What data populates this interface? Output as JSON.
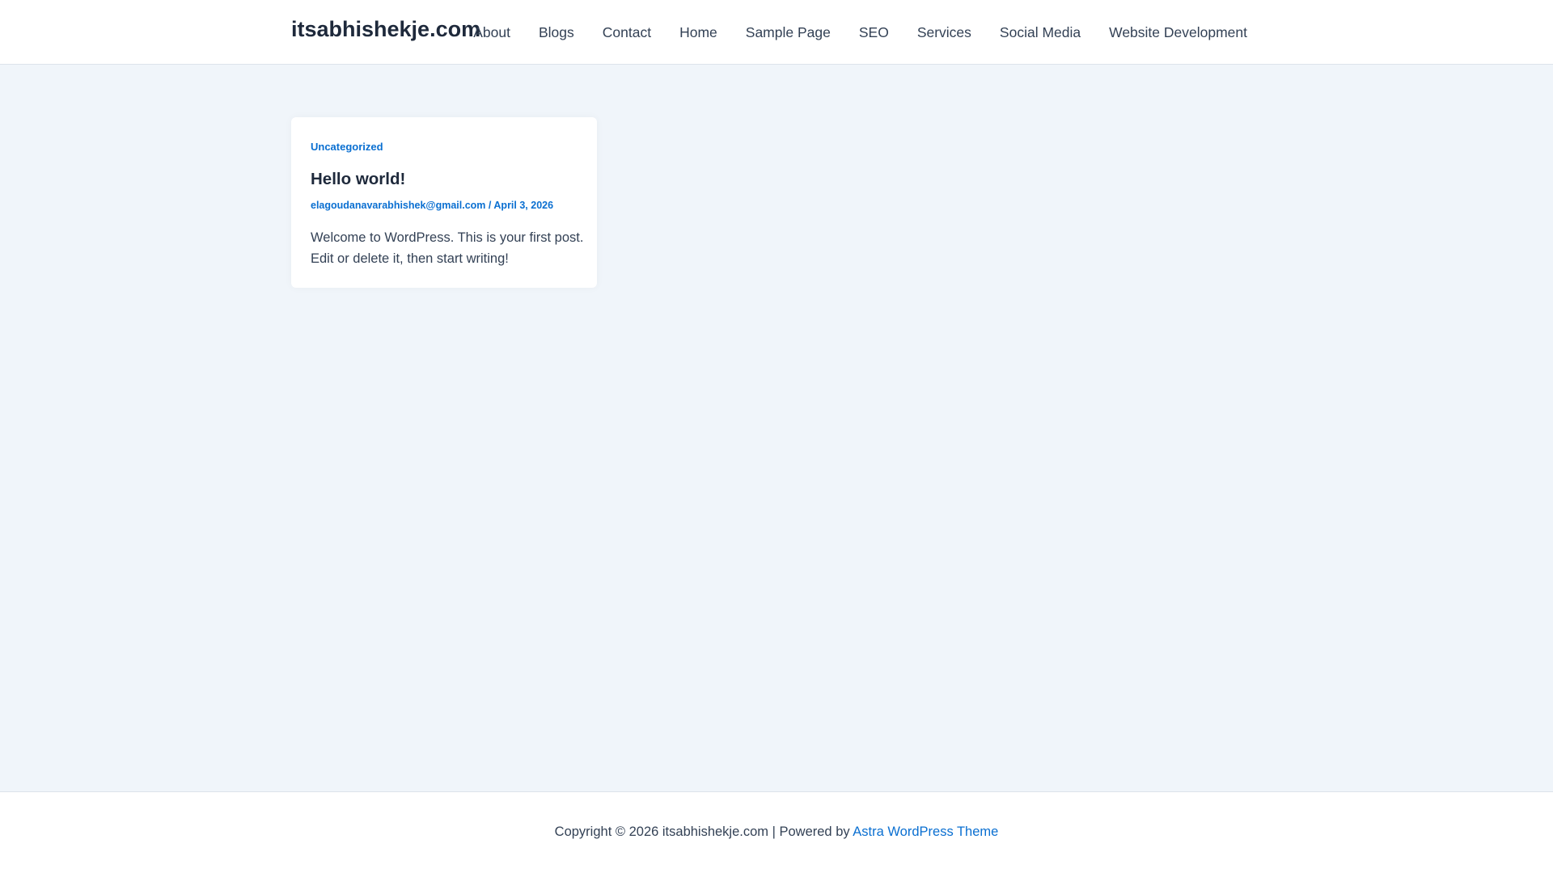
{
  "header": {
    "site_title": "itsabhishekje.com",
    "nav": [
      "About",
      "Blogs",
      "Contact",
      "Home",
      "Sample Page",
      "SEO",
      "Services",
      "Social Media",
      "Website Development"
    ]
  },
  "post": {
    "category": "Uncategorized",
    "title": "Hello world!",
    "author": "elagoudanavarabhishek@gmail.com",
    "separator": " / ",
    "date": "April 3, 2026",
    "excerpt": "Welcome to WordPress. This is your first post. Edit or delete it, then start writing!"
  },
  "footer": {
    "text": "Copyright © 2026 itsabhishekje.com | Powered by ",
    "link": "Astra WordPress Theme"
  }
}
